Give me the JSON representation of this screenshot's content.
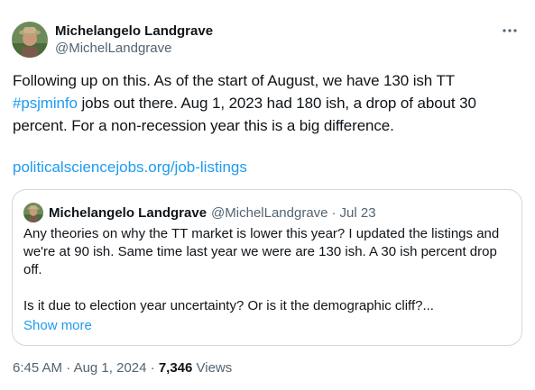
{
  "author": {
    "display_name": "Michelangelo Landgrave",
    "handle": "@MichelLandgrave"
  },
  "tweet": {
    "text_before_hashtag": "Following up on this. As of the start of August, we have 130 ish TT ",
    "hashtag": "#psjminfo",
    "text_after_hashtag": " jobs out there. Aug 1, 2023 had 180 ish, a drop of about 30 percent. For a non-recession year this is a big difference.",
    "link": "politicalsciencejobs.org/job-listings"
  },
  "quoted": {
    "display_name": "Michelangelo Landgrave",
    "handle": "@MichelLandgrave",
    "separator": "·",
    "date": "Jul 23",
    "paragraph1": "Any theories on why the TT market is lower this year? I updated the listings and we're at 90 ish. Same time last year we were are 130 ish. A 30 ish percent drop off.",
    "paragraph2": "Is it due to election year uncertainty? Or is it the demographic cliff?...",
    "show_more": "Show more"
  },
  "meta": {
    "time": "6:45 AM",
    "sep1": " · ",
    "date": "Aug 1, 2024",
    "sep2": " · ",
    "views_count": "7,346",
    "views_label": " Views"
  },
  "icons": {
    "more": "more-horizontal-icon"
  },
  "colors": {
    "link": "#1d9bf0",
    "secondary_text": "#536471",
    "primary_text": "#0f1419",
    "border": "#cfd9de"
  }
}
